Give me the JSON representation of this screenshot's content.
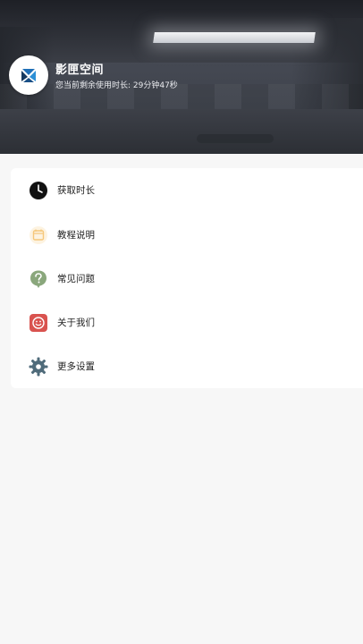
{
  "profile": {
    "app_name": "影匣空间",
    "remaining_text": "您当前剩余使用时长: 29分钟47秒"
  },
  "menu": {
    "items": [
      {
        "label": "获取时长",
        "icon": "clock-icon"
      },
      {
        "label": "教程说明",
        "icon": "calendar-icon"
      },
      {
        "label": "常见问题",
        "icon": "question-icon"
      },
      {
        "label": "关于我们",
        "icon": "smile-icon"
      },
      {
        "label": "更多设置",
        "icon": "gear-icon"
      }
    ]
  },
  "colors": {
    "hero_bg": "#3f434c",
    "card_bg": "#ffffff",
    "page_bg": "#f7f7f7",
    "clock": "#111111",
    "calendar": "#f5c77a",
    "question": "#8aa77c",
    "smile": "#d9534f",
    "gear": "#4f6b7a"
  }
}
